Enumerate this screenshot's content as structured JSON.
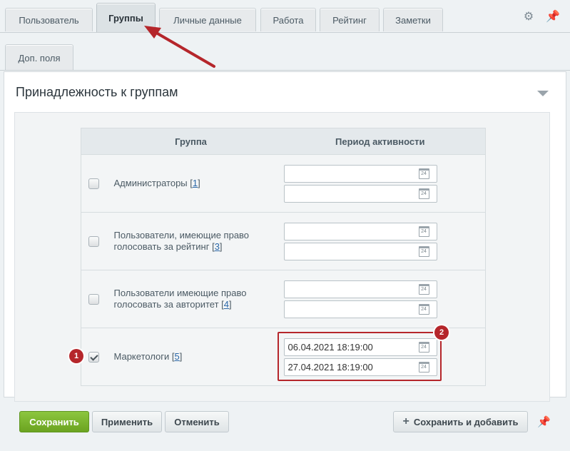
{
  "tabs": {
    "user": "Пользователь",
    "groups": "Группы",
    "personal": "Личные данные",
    "work": "Работа",
    "rating": "Рейтинг",
    "notes": "Заметки",
    "extra": "Доп. поля"
  },
  "panel": {
    "title": "Принадлежность к группам"
  },
  "table": {
    "col_group": "Группа",
    "col_period": "Период активности",
    "rows": [
      {
        "name": "Администраторы",
        "id": "1",
        "from": "",
        "to": "",
        "checked": false
      },
      {
        "name_line1": "Пользователи, имеющие право",
        "name_line2": "голосовать за рейтинг",
        "id": "3",
        "from": "",
        "to": "",
        "checked": false
      },
      {
        "name_line1": "Пользователи имеющие право",
        "name_line2": "голосовать за авторитет",
        "id": "4",
        "from": "",
        "to": "",
        "checked": false
      },
      {
        "name": "Маркетологи",
        "id": "5",
        "from": "06.04.2021 18:19:00",
        "to": "27.04.2021 18:19:00",
        "checked": true
      }
    ]
  },
  "calendar_icon_text": "24",
  "annotations": {
    "badge1": "1",
    "badge2": "2"
  },
  "buttons": {
    "save": "Сохранить",
    "apply": "Применить",
    "cancel": "Отменить",
    "save_add": "Сохранить и добавить",
    "save_add_prefix": "+"
  },
  "icons": {
    "settings": "gear-icon",
    "pin": "pin-icon",
    "calendar": "calendar-icon"
  },
  "colors": {
    "accent_red": "#b5262b",
    "save_green": "#7ab62f"
  }
}
